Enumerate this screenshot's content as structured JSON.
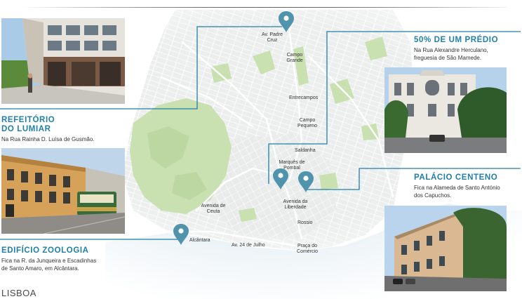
{
  "map": {
    "title": "LISBOA",
    "places": {
      "av_padre_cruz": "Av. Padre Cruz",
      "campo_grande": "Campo Grande",
      "entrecampos": "Entrecampos",
      "campo_pequeno": "Campo Pequeno",
      "saldanha": "Saldanha",
      "marques_de_pombal": "Marquês de Pombal",
      "avenida_da_liberdade": "Avenida da Liberdade",
      "avenida_de_ceuta": "Avenida de Ceuta",
      "rossio": "Rossio",
      "alcantara": "Alcântara",
      "av_24_de_julho": "Av. 24 de Julho",
      "praca_do_comercio": "Praça do Comércio"
    },
    "accent_color": "#1f7fa8",
    "pin_color": "#4f93ad"
  },
  "callouts": {
    "refeitorio": {
      "title_line1": "REFEITÓRIO",
      "title_line2": "DO LUMIAR",
      "subtitle": "Na Rua Rainha D. Luísa de Gusmão."
    },
    "predio": {
      "title": "50% DE UM PRÉDIO",
      "subtitle_line1": "Na Rua Alexandre Herculano,",
      "subtitle_line2": "freguesia de São Mamede."
    },
    "centeno": {
      "title": "PALÁCIO CENTENO",
      "subtitle_line1": "Fica na Alameda de Santo António",
      "subtitle_line2": "dos Capuchos."
    },
    "zoologia": {
      "title": "EDIFÍCIO ZOOLOGIA",
      "subtitle_line1": "Fica na R. da Junqueira e Escadinhas",
      "subtitle_line2": "de Santo Amaro, em Alcântara."
    }
  }
}
